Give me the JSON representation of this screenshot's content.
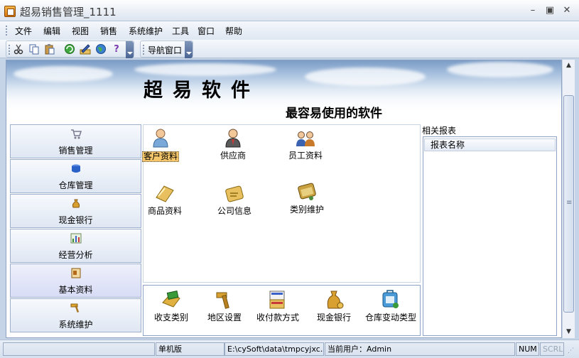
{
  "window": {
    "title": "超易销售管理_1111"
  },
  "menu": [
    "文件",
    "编辑",
    "视图",
    "销售",
    "系统维护",
    "工具",
    "窗口",
    "帮助"
  ],
  "toolbar": {
    "icons": [
      "cut-icon",
      "copy-icon",
      "paste-icon",
      "refresh-icon",
      "edit-icon",
      "globe-icon",
      "help-icon"
    ],
    "nav_window_label": "导航窗口"
  },
  "banner": {
    "title": "超易软件",
    "slogan": "最容易使用的软件"
  },
  "nav": {
    "items": [
      {
        "label": "销售管理",
        "icon": "cart-icon",
        "color": "#8a8a9a"
      },
      {
        "label": "仓库管理",
        "icon": "warehouse-icon",
        "color": "#2a62c8"
      },
      {
        "label": "现金银行",
        "icon": "money-bag-icon",
        "color": "#c98e1c"
      },
      {
        "label": "经营分析",
        "icon": "bar-chart-icon",
        "color": "#2f8a3a"
      },
      {
        "label": "基本资料",
        "icon": "document-icon",
        "color": "#b56a1a",
        "active": true
      },
      {
        "label": "系统维护",
        "icon": "hammer-icon",
        "color": "#d49a20"
      }
    ]
  },
  "top_tiles": [
    {
      "label": "客户资料",
      "icon": "customer-icon",
      "selected": true
    },
    {
      "label": "供应商",
      "icon": "supplier-icon"
    },
    {
      "label": "员工资料",
      "icon": "staff-icon"
    },
    {
      "label": "商品资料",
      "icon": "goods-icon"
    },
    {
      "label": "公司信息",
      "icon": "company-info-icon"
    },
    {
      "label": "类别维护",
      "icon": "category-icon"
    }
  ],
  "bottom_tiles": [
    {
      "label": "收支类别",
      "icon": "income-expense-icon"
    },
    {
      "label": "地区设置",
      "icon": "region-icon"
    },
    {
      "label": "收付款方式",
      "icon": "payment-method-icon"
    },
    {
      "label": "现金银行",
      "icon": "cash-bank-icon"
    },
    {
      "label": "仓库变动类型",
      "icon": "stock-change-icon"
    }
  ],
  "reports": {
    "title": "相关报表",
    "column_header": "报表名称"
  },
  "status": {
    "mode": "单机版",
    "db_path": "E:\\cySoft\\data\\tmpcyjxc.sys",
    "user": "当前用户：Admin",
    "num": "NUM",
    "scrl": "SCRL"
  }
}
